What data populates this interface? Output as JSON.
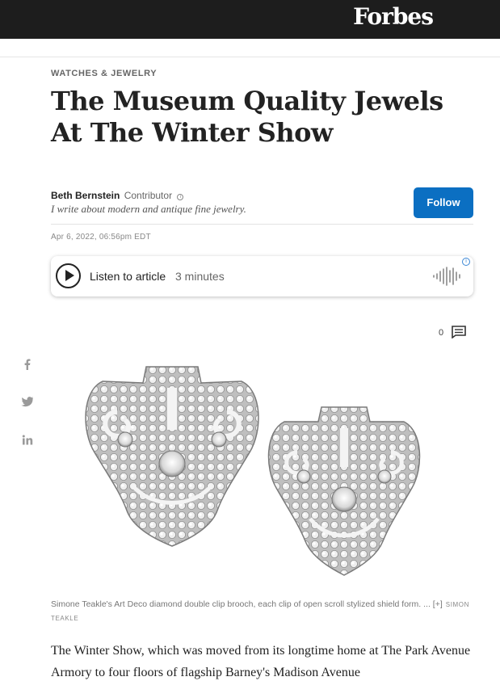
{
  "header": {
    "logo": "Forbes"
  },
  "article": {
    "section": "WATCHES & JEWELRY",
    "headline": "The Museum Quality Jewels At The Winter Show",
    "author": {
      "name": "Beth Bernstein",
      "role": "Contributor",
      "bio": "I write about modern and antique fine jewelry."
    },
    "follow_label": "Follow",
    "date": "Apr 6, 2022, 06:56pm EDT",
    "listen": {
      "label": "Listen to article",
      "duration": "3 minutes"
    },
    "comments_count": "0",
    "image": {
      "caption": "Simone Teakle's Art Deco diamond double clip brooch, each clip of open scroll stylized shield form. ... [+]",
      "credit": "SIMON TEAKLE"
    },
    "body": "The Winter Show, which was moved from its longtime home at The Park Avenue Armory to four floors of flagship Barney's Madison Avenue"
  },
  "share": {
    "icons": [
      "facebook-icon",
      "twitter-icon",
      "linkedin-icon"
    ]
  },
  "colors": {
    "topbar": "#1d1d1d",
    "follow": "#0b6fc2"
  }
}
